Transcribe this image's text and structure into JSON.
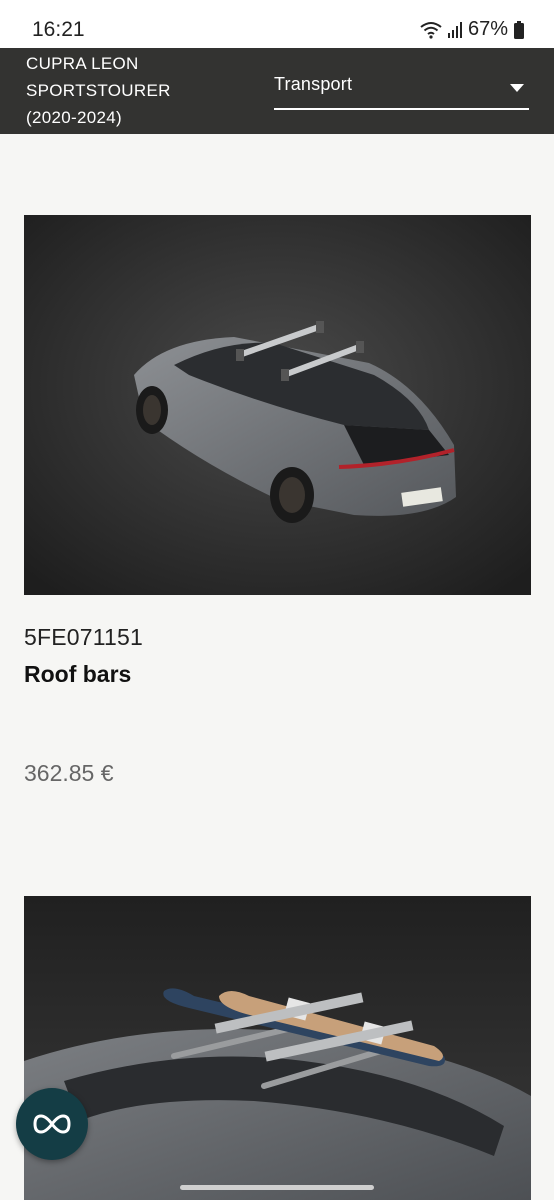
{
  "status_bar": {
    "time": "16:21",
    "battery": "67%",
    "icons": [
      "wifi-icon",
      "signal-icon",
      "battery-icon"
    ]
  },
  "header": {
    "model_title": "CUPRA LEON\nSPORTSTOURER\n(2020-2024)",
    "category": "Transport",
    "icons": [
      "chevron-down-icon"
    ]
  },
  "products": [
    {
      "part_number": "5FE071151",
      "name": "Roof bars",
      "price": "362.85 €",
      "image": "product-photo-roof-bars"
    },
    {
      "image": "product-photo-ski-rack"
    }
  ],
  "fab": {
    "icon": "cupra-logo-icon"
  },
  "colors": {
    "header_bg": "#333331",
    "page_bg": "#f6f6f4",
    "fab_bg": "#143d45"
  }
}
